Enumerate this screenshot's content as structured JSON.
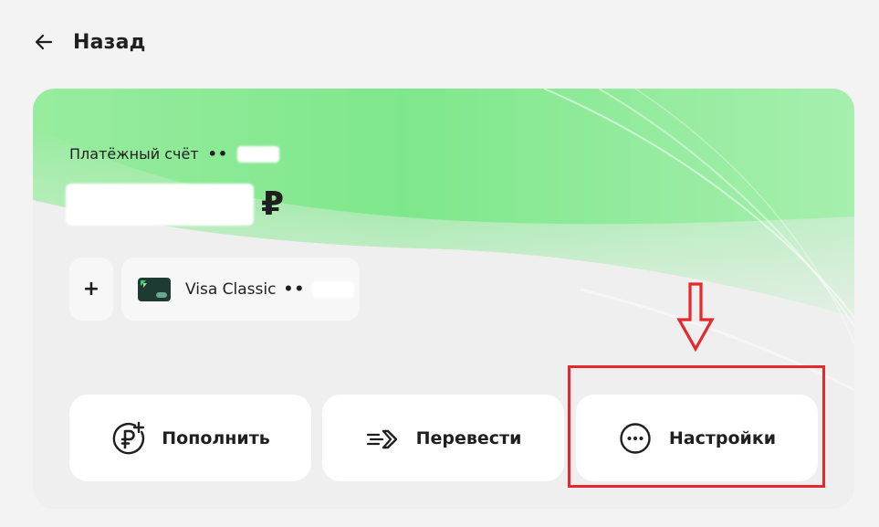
{
  "back": {
    "label": "Назад",
    "icon": "arrow-left-icon"
  },
  "account": {
    "title": "Платёжный счёт",
    "number_mask": "••",
    "currency_symbol": "₽",
    "card": {
      "name": "Visa Classic",
      "number_mask": "••",
      "icon": "card-thumbnail-icon"
    },
    "add_label": "+"
  },
  "actions": [
    {
      "label": "Пополнить",
      "icon": "ruble-plus-icon"
    },
    {
      "label": "Перевести",
      "icon": "transfer-arrow-icon"
    },
    {
      "label": "Настройки",
      "icon": "more-horizontal-icon"
    }
  ],
  "colors": {
    "accent_green": "#7ee68e",
    "annotation_red": "#e5282c",
    "background": "#f3f3f3",
    "text": "#1f1f1f"
  }
}
